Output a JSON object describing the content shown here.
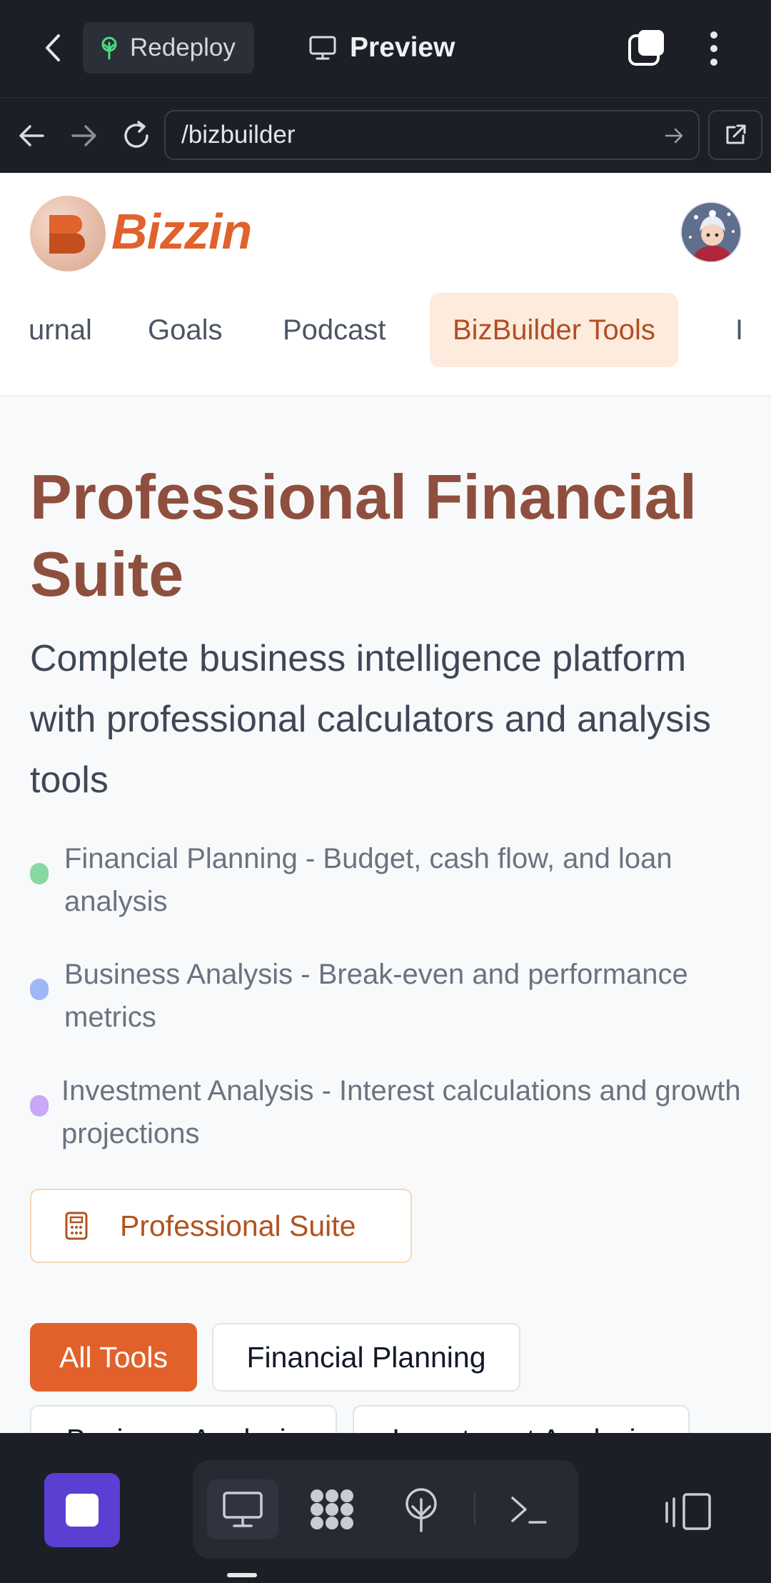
{
  "app_bar": {
    "redeploy_label": "Redeploy",
    "preview_label": "Preview"
  },
  "url_bar": {
    "url": "/bizbuilder"
  },
  "site": {
    "brand": "Bizzin",
    "nav": [
      {
        "label": "urnal"
      },
      {
        "label": "Goals"
      },
      {
        "label": "Podcast"
      },
      {
        "label": "BizBuilder Tools",
        "active": true
      },
      {
        "label": "I"
      }
    ],
    "hero_title": "Professional Financial Suite",
    "hero_subtitle": "Complete business intelligence platform with professional calculators and analysis tools",
    "features": [
      {
        "text": "Financial Planning - Budget, cash flow, and loan analysis",
        "color": "#86d9a1"
      },
      {
        "text": "Business Analysis - Break-even and performance metrics",
        "color": "#9db8f5"
      },
      {
        "text": "Investment Analysis - Interest calculations and growth projections",
        "color": "#c9a8f7"
      }
    ],
    "suite_button": "Professional Suite",
    "filters": [
      {
        "label": "All Tools",
        "active": true
      },
      {
        "label": "Financial Planning",
        "active": false
      },
      {
        "label": "Business Analysis",
        "active": false
      },
      {
        "label": "Investment Analysis",
        "active": false
      }
    ]
  },
  "colors": {
    "accent": "#e2612b",
    "title": "#8f4f3e",
    "dark_bar": "#1c1f26",
    "home_app": "#5b3fd3"
  },
  "icons": [
    "back-arrow-icon",
    "tree-icon",
    "monitor-icon",
    "tabs-icon",
    "more-vertical-icon",
    "arrow-left-icon",
    "arrow-right-icon",
    "reload-icon",
    "arrow-go-icon",
    "external-link-icon",
    "calculator-icon",
    "desktop-icon",
    "integrations-icon",
    "deploy-icon",
    "terminal-icon",
    "device-toggle-icon"
  ]
}
